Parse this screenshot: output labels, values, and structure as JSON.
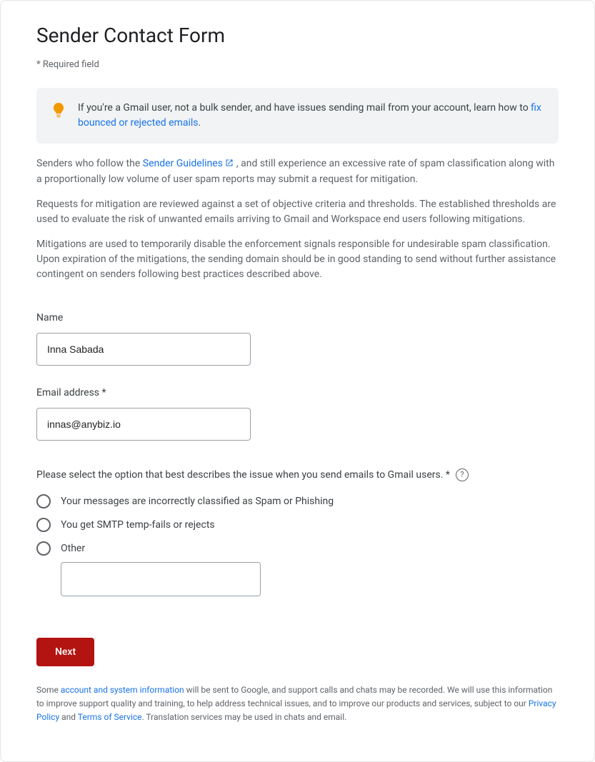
{
  "title": "Sender Contact Form",
  "required_note": "* Required field",
  "tip": {
    "prefix": "If you're a Gmail user, not a bulk sender, and have issues sending mail from your account, learn how to ",
    "link_text": "fix bounced or rejected emails",
    "suffix": "."
  },
  "intro": {
    "p1_a": "Senders who follow the ",
    "p1_link": "Sender Guidelines",
    "p1_b": " , and still experience an excessive rate of spam classification along with a proportionally low volume of user spam reports may submit a request for mitigation.",
    "p2": "Requests for mitigation are reviewed against a set of objective criteria and thresholds. The established thresholds are used to evaluate the risk of unwanted emails arriving to Gmail and Workspace end users following mitigations.",
    "p3": "Mitigations are used to temporarily disable the enforcement signals responsible for undesirable spam classification. Upon expiration of the mitigations, the sending domain should be in good standing to send without further assistance contingent on senders following best practices described above."
  },
  "fields": {
    "name_label": "Name",
    "name_value": "Inna Sabada",
    "email_label": "Email address *",
    "email_value": "innas@anybiz.io"
  },
  "issue": {
    "label": "Please select the option that best describes the issue when you send emails to Gmail users. *",
    "options": [
      "Your messages are incorrectly classified as Spam or Phishing",
      "You get SMTP temp-fails or rejects",
      "Other"
    ],
    "other_value": ""
  },
  "buttons": {
    "next": "Next"
  },
  "disclaimer": {
    "a": "Some ",
    "link1": "account and system information",
    "b": " will be sent to Google, and support calls and chats may be recorded. We will use this information to improve support quality and training, to help address technical issues, and to improve our products and services, subject to our ",
    "link2": "Privacy Policy",
    "c": " and ",
    "link3": "Terms of Service",
    "d": ". Translation services may be used in chats and email."
  }
}
